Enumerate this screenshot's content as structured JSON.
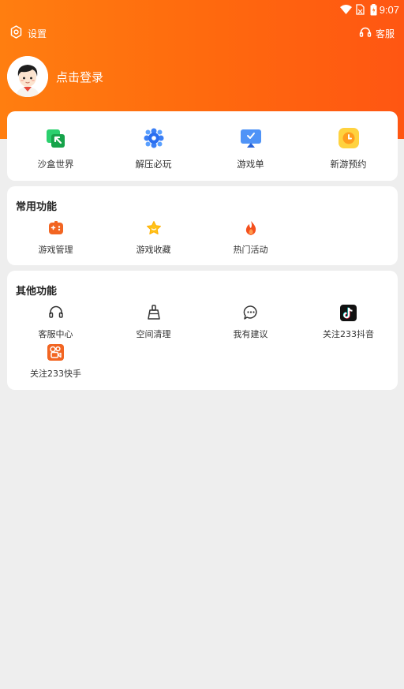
{
  "status": {
    "time": "9:07"
  },
  "header": {
    "settings_label": "设置",
    "service_label": "客服",
    "login_text": "点击登录"
  },
  "top_grid": [
    {
      "label": "沙盒世界",
      "icon": "sandbox-icon"
    },
    {
      "label": "解压必玩",
      "icon": "relax-icon"
    },
    {
      "label": "游戏单",
      "icon": "game-list-icon"
    },
    {
      "label": "新游预约",
      "icon": "reserve-clock-icon"
    }
  ],
  "common": {
    "title": "常用功能",
    "items": [
      {
        "label": "游戏管理",
        "icon": "gamepad-icon"
      },
      {
        "label": "游戏收藏",
        "icon": "star-icon"
      },
      {
        "label": "热门活动",
        "icon": "fire-icon"
      }
    ]
  },
  "other": {
    "title": "其他功能",
    "items": [
      {
        "label": "客服中心",
        "icon": "headset-icon"
      },
      {
        "label": "空间清理",
        "icon": "broom-icon"
      },
      {
        "label": "我有建议",
        "icon": "chat-bubble-icon"
      },
      {
        "label": "关注233抖音",
        "icon": "douyin-icon"
      },
      {
        "label": "关注233快手",
        "icon": "kuaishou-icon"
      }
    ]
  },
  "colors": {
    "header_start": "#ff7e10",
    "header_end": "#ff5612",
    "accent": "#f26522",
    "background": "#eeeeee"
  }
}
